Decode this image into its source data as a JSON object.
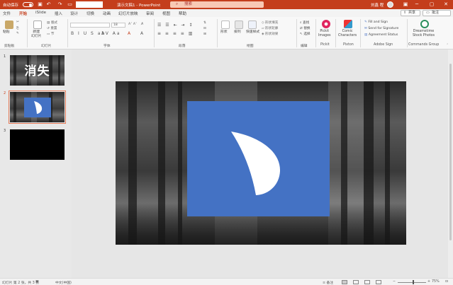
{
  "titlebar": {
    "autosave_label": "自动保存",
    "doc_title": "演示文稿1 - PowerPoint",
    "search_placeholder": "搜索",
    "user_name": "刘鑫 程",
    "quick_icons": [
      "save-icon",
      "undo-icon",
      "redo-icon",
      "present-icon"
    ],
    "controls": [
      "ribbon-display-icon",
      "minimize-icon",
      "restore-icon",
      "close-icon"
    ]
  },
  "tabs": [
    "文件",
    "开始",
    "iSlide",
    "插入",
    "设计",
    "切换",
    "动画",
    "幻灯片放映",
    "审阅",
    "视图",
    "帮助"
  ],
  "active_tab": "开始",
  "share_label": "共享",
  "comment_label": "批注",
  "ribbon": {
    "paste": "粘贴",
    "new_slide": "新建\n幻灯片",
    "layout": "版式",
    "reset": "重置",
    "section": "节",
    "font_size": "18",
    "shape_label": "形状",
    "arrange_label": "排列",
    "quick_styles": "快速样式",
    "shape_fill": "形状填充",
    "shape_outline": "形状轮廓",
    "shape_effects": "形状效果",
    "find": "查找",
    "replace": "替换",
    "select": "选择",
    "pickit": "Pickit\nImages",
    "comic": "Comic\nCharacters",
    "fill_sign": "Fill and Sign",
    "send_sig": "Send for Signature",
    "agreement": "Agreement Status",
    "dreamstime": "Dreamstime\nStock Photos",
    "groups": [
      "剪贴板",
      "幻灯片",
      "字体",
      "段落",
      "绘图",
      "编辑",
      "Pickit",
      "Pixton",
      "Adobe Sign",
      "Commands Group"
    ]
  },
  "slides": [
    {
      "number": "1",
      "title": "消失"
    },
    {
      "number": "2"
    },
    {
      "number": "3"
    }
  ],
  "selected_slide": 2,
  "statusbar": {
    "slide_info": "幻灯片 第 2 张，共 3 张",
    "language": "中文(中国)",
    "notes": "备注",
    "zoom": "75%"
  },
  "colors": {
    "accent": "#c43e1c",
    "shape_blue": "#4472c4"
  }
}
